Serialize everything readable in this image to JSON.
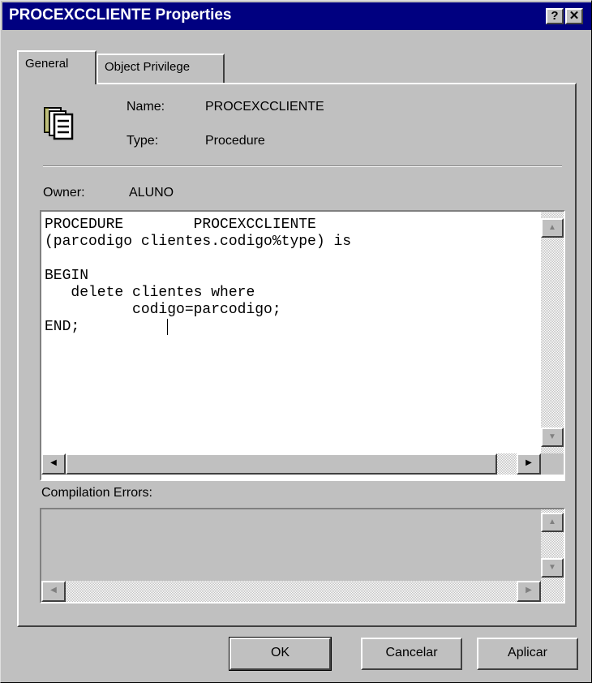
{
  "window": {
    "title": "PROCEXCCLIENTE Properties",
    "help_label": "?",
    "close_label": "✕"
  },
  "tabs": [
    {
      "label": "General",
      "selected": true
    },
    {
      "label": "Object Privilege",
      "selected": false
    }
  ],
  "object": {
    "icon": "procedure-document-icon",
    "name_label": "Name:",
    "name_value": "PROCEXCCLIENTE",
    "type_label": "Type:",
    "type_value": "Procedure",
    "owner_label": "Owner:",
    "owner_value": "ALUNO"
  },
  "source": {
    "code": "PROCEDURE        PROCEXCCLIENTE\n(parcodigo clientes.codigo%type) is\n\nBEGIN\n   delete clientes where\n          codigo=parcodigo;\nEND;"
  },
  "errors": {
    "label": "Compilation Errors:",
    "text": ""
  },
  "buttons": {
    "ok": "OK",
    "cancel": "Cancelar",
    "apply": "Aplicar"
  },
  "colors": {
    "title_bar": "#000080",
    "face": "#c0c0c0"
  }
}
